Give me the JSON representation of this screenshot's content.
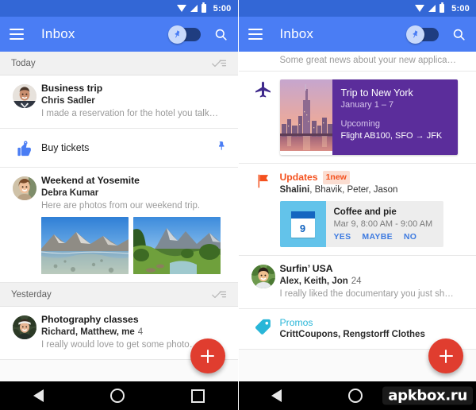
{
  "status_bar": {
    "time": "5:00",
    "icons": [
      "wifi-icon",
      "signal-icon",
      "battery-icon"
    ]
  },
  "app_bar": {
    "title": "Inbox",
    "menu_icon": "hamburger-menu-icon",
    "toggle_icon": "pin-toggle-icon",
    "search_icon": "search-icon"
  },
  "colors": {
    "status_bar": "#3367D6",
    "app_bar": "#4A7DF4",
    "fab": "#E03D2F",
    "updates_accent": "#F4511E",
    "promos_accent": "#29B6D8",
    "trip_card": "#5B2D9B",
    "calendar_thumb": "#63C3EA"
  },
  "left_phone": {
    "sections": [
      {
        "label": "Today",
        "sweep_icon": "done-all-icon",
        "items": [
          {
            "type": "mail",
            "icon": "avatar",
            "subject": "Business trip",
            "senders": "Chris Sadler",
            "count": "",
            "snippet": "I made a reservation for the hotel you talk…"
          },
          {
            "type": "reminder",
            "icon": "reminder-finger-icon",
            "subject": "Buy tickets",
            "trailing_icon": "pin-icon"
          },
          {
            "type": "mail",
            "icon": "avatar",
            "subject": "Weekend at Yosemite",
            "senders": "Debra Kumar",
            "count": "",
            "snippet": "Here are photos from our weekend trip.",
            "photos": [
              "yosemite-lake-photo",
              "yosemite-valley-photo"
            ]
          }
        ]
      },
      {
        "label": "Yesterday",
        "sweep_icon": "done-all-icon",
        "items": [
          {
            "type": "mail",
            "icon": "avatar",
            "subject": "Photography classes",
            "senders": "Richard, Matthew, me",
            "count": "4",
            "snippet": "I really would love to get some photo…"
          }
        ]
      }
    ],
    "fab_label": "compose-fab"
  },
  "right_phone": {
    "top_snippet": "Some great news about your new applica…",
    "items": [
      {
        "type": "trip",
        "icon": "airplane-icon",
        "thumb": "new-york-skyline-photo",
        "title": "Trip to New York",
        "dates": "January 1 – 7",
        "status": "Upcoming",
        "flight": "Flight AB100,  SFO → JFK"
      },
      {
        "type": "cluster",
        "icon": "flag-icon",
        "title": "Updates",
        "badge": "1new",
        "senders_bold": "Shalini",
        "senders_rest": ", Bhavik, Peter, Jason",
        "card": {
          "thumb_icon": "calendar-icon",
          "day": "9",
          "title": "Coffee and pie",
          "when": "Mar 9, 8:00 AM - 9:00 AM",
          "actions": [
            "YES",
            "MAYBE",
            "NO"
          ]
        }
      },
      {
        "type": "mail",
        "icon": "avatar",
        "subject": "Surfin’ USA",
        "senders": "Alex, Keith, Jon",
        "count": "24",
        "snippet": "I really liked the documentary you just sh…"
      },
      {
        "type": "cluster",
        "icon": "tag-icon",
        "title": "Promos",
        "senders": "CrittCoupons, Rengstorff Clothes"
      }
    ],
    "fab_label": "compose-fab"
  },
  "nav_bar": {
    "back": "back-triangle-icon",
    "home": "home-circle-icon",
    "recents": "recents-square-icon"
  },
  "watermark": "apkbox.ru"
}
